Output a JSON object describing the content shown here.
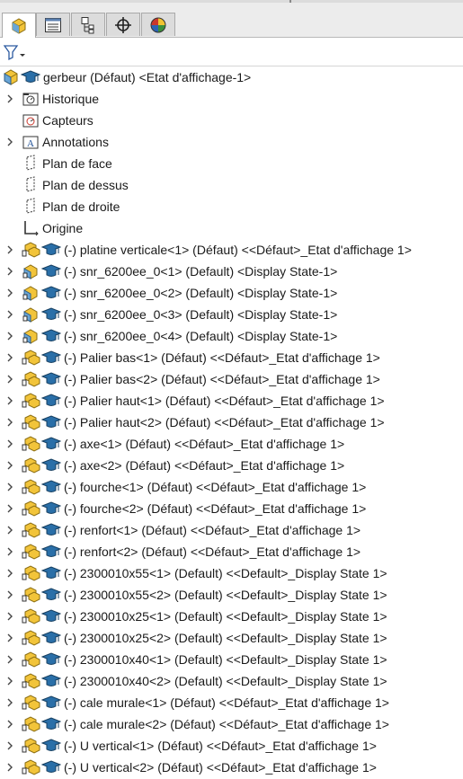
{
  "tabs": [
    {
      "icon": "feature-manager-icon",
      "active": true
    },
    {
      "icon": "property-manager-icon",
      "active": false
    },
    {
      "icon": "configuration-manager-icon",
      "active": false
    },
    {
      "icon": "dimxpert-manager-icon",
      "active": false
    },
    {
      "icon": "display-manager-icon",
      "active": false
    }
  ],
  "filter": {
    "icon": "filter-icon"
  },
  "root": {
    "label": "gerbeur  (Défaut) <Etat d'affichage-1>"
  },
  "folders": [
    {
      "label": "Historique",
      "icon": "history-folder-icon",
      "expandable": true
    },
    {
      "label": "Capteurs",
      "icon": "sensors-folder-icon",
      "expandable": false
    },
    {
      "label": "Annotations",
      "icon": "annotations-folder-icon",
      "expandable": true
    },
    {
      "label": "Plan de face",
      "icon": "plane-icon",
      "expandable": false
    },
    {
      "label": "Plan de dessus",
      "icon": "plane-icon",
      "expandable": false
    },
    {
      "label": "Plan de droite",
      "icon": "plane-icon",
      "expandable": false
    },
    {
      "label": "Origine",
      "icon": "origin-icon",
      "expandable": false
    }
  ],
  "components": [
    {
      "label": "(-) platine verticale<1> (Défaut) <<Défaut>_Etat d'affichage 1>",
      "kind": "assembly"
    },
    {
      "label": "(-) snr_6200ee_0<1> (Default) <Display State-1>",
      "kind": "assembly-blue"
    },
    {
      "label": "(-) snr_6200ee_0<2> (Default) <Display State-1>",
      "kind": "assembly-blue"
    },
    {
      "label": "(-) snr_6200ee_0<3> (Default) <Display State-1>",
      "kind": "assembly-blue"
    },
    {
      "label": "(-) snr_6200ee_0<4> (Default) <Display State-1>",
      "kind": "assembly-blue"
    },
    {
      "label": "(-) Palier bas<1> (Défaut) <<Défaut>_Etat d'affichage 1>",
      "kind": "assembly"
    },
    {
      "label": "(-) Palier bas<2> (Défaut) <<Défaut>_Etat d'affichage 1>",
      "kind": "assembly"
    },
    {
      "label": "(-) Palier haut<1> (Défaut) <<Défaut>_Etat d'affichage 1>",
      "kind": "assembly"
    },
    {
      "label": "(-) Palier haut<2> (Défaut) <<Défaut>_Etat d'affichage 1>",
      "kind": "assembly"
    },
    {
      "label": "(-) axe<1> (Défaut) <<Défaut>_Etat d'affichage 1>",
      "kind": "assembly"
    },
    {
      "label": "(-) axe<2> (Défaut) <<Défaut>_Etat d'affichage 1>",
      "kind": "assembly"
    },
    {
      "label": "(-) fourche<1> (Défaut) <<Défaut>_Etat d'affichage 1>",
      "kind": "assembly"
    },
    {
      "label": "(-) fourche<2> (Défaut) <<Défaut>_Etat d'affichage 1>",
      "kind": "assembly"
    },
    {
      "label": "(-) renfort<1> (Défaut) <<Défaut>_Etat d'affichage 1>",
      "kind": "assembly"
    },
    {
      "label": "(-) renfort<2> (Défaut) <<Défaut>_Etat d'affichage 1>",
      "kind": "assembly"
    },
    {
      "label": "(-) 2300010x55<1> (Default) <<Default>_Display State 1>",
      "kind": "assembly"
    },
    {
      "label": "(-) 2300010x55<2> (Default) <<Default>_Display State 1>",
      "kind": "assembly"
    },
    {
      "label": "(-) 2300010x25<1> (Default) <<Default>_Display State 1>",
      "kind": "assembly"
    },
    {
      "label": "(-) 2300010x25<2> (Default) <<Default>_Display State 1>",
      "kind": "assembly"
    },
    {
      "label": "(-) 2300010x40<1> (Default) <<Default>_Display State 1>",
      "kind": "assembly"
    },
    {
      "label": "(-) 2300010x40<2> (Default) <<Default>_Display State 1>",
      "kind": "assembly"
    },
    {
      "label": "(-) cale murale<1> (Défaut) <<Défaut>_Etat d'affichage 1>",
      "kind": "assembly"
    },
    {
      "label": "(-) cale murale<2> (Défaut) <<Défaut>_Etat d'affichage 1>",
      "kind": "assembly"
    },
    {
      "label": "(-) U vertical<1> (Défaut) <<Défaut>_Etat d'affichage 1>",
      "kind": "assembly"
    },
    {
      "label": "(-) U vertical<2> (Défaut) <<Défaut>_Etat d'affichage 1>",
      "kind": "assembly"
    }
  ],
  "colors": {
    "assembly_yellow": "#f2c43a",
    "part_blue": "#6aa6d6",
    "display_teal": "#2a6fa8",
    "tree_text": "#1a1a1a"
  }
}
